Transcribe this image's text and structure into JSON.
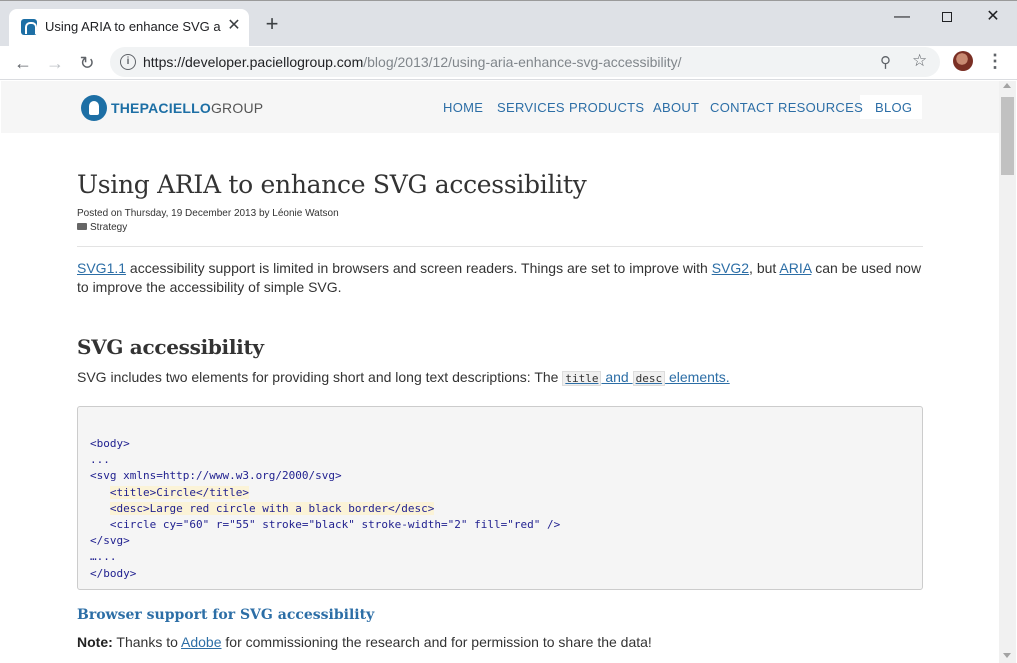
{
  "browser": {
    "tab_title": "Using ARIA to enhance SVG acce",
    "url_host": "https://developer.paciellogroup.com",
    "url_path": "/blog/2013/12/using-aria-enhance-svg-accessibility/"
  },
  "site": {
    "logo_the": "THE",
    "logo_paciello": "PACIELLO",
    "logo_group": "GROUP",
    "nav": [
      "HOME",
      "SERVICES",
      "PRODUCTS",
      "ABOUT",
      "CONTACT",
      "RESOURCES",
      "BLOG"
    ]
  },
  "post": {
    "title": "Using ARIA to enhance SVG accessibility",
    "meta_date": "Posted on Thursday, 19 December 2013 by Léonie Watson",
    "category": "Strategy",
    "intro": {
      "link_svg11": "SVG1.1",
      "text1": " accessibility support is limited in browsers and screen readers. Things are set to improve with ",
      "link_svg2": "SVG2",
      "text2": ", but ",
      "link_aria": "ARIA",
      "text3": " can be used now to improve the accessibility of simple SVG."
    },
    "h2": "SVG accessibility",
    "p2": {
      "text": "SVG includes two elements for providing short and long text descriptions: The ",
      "code_title": "title",
      "and": " and ",
      "code_desc": "desc",
      "elements": " elements."
    },
    "code_lines": [
      "<body>",
      "...",
      "<svg xmlns=http://www.w3.org/2000/svg>",
      "<title>Circle</title>",
      "<desc>Large red circle with a black border</desc>",
      "<circle cy=\"60\" r=\"55\" stroke=\"black\" stroke-width=\"2\" fill=\"red\" />",
      "</svg>",
      "…...",
      "</body>"
    ],
    "h3": "Browser support for SVG accessibility",
    "note_label": "Note:",
    "note_text1": " Thanks to ",
    "note_link": "Adobe",
    "note_text2": " for commissioning the research and for permission to share the data!"
  },
  "colors": {
    "link": "#2c6ea6",
    "brand": "#1d6fa5"
  }
}
